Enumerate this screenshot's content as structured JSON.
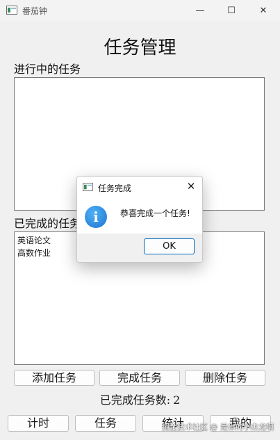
{
  "window": {
    "title": "番茄钟",
    "minimize_glyph": "—",
    "maximize_glyph": "☐",
    "close_glyph": "✕"
  },
  "main": {
    "heading": "任务管理",
    "in_progress_label": "进行中的任务",
    "in_progress_items": [],
    "completed_label": "已完成的任务",
    "completed_items": [
      "英语论文",
      "高数作业"
    ],
    "buttons": {
      "add": "添加任务",
      "complete": "完成任务",
      "delete": "删除任务"
    },
    "completed_count_label": "已完成任务数:",
    "completed_count": "2"
  },
  "nav": {
    "timer": "计时",
    "tasks": "任务",
    "stats": "统计",
    "mine": "我的"
  },
  "watermark": "掘金技术社区 @ 是你的小杰龙啊",
  "dialog": {
    "title": "任务完成",
    "message": "恭喜完成一个任务!",
    "ok": "OK",
    "close_glyph": "✕",
    "info_glyph": "i"
  },
  "colors": {
    "background": "#f0f0f0",
    "accent": "#0067c0",
    "info_blue": "#1a73d1"
  }
}
